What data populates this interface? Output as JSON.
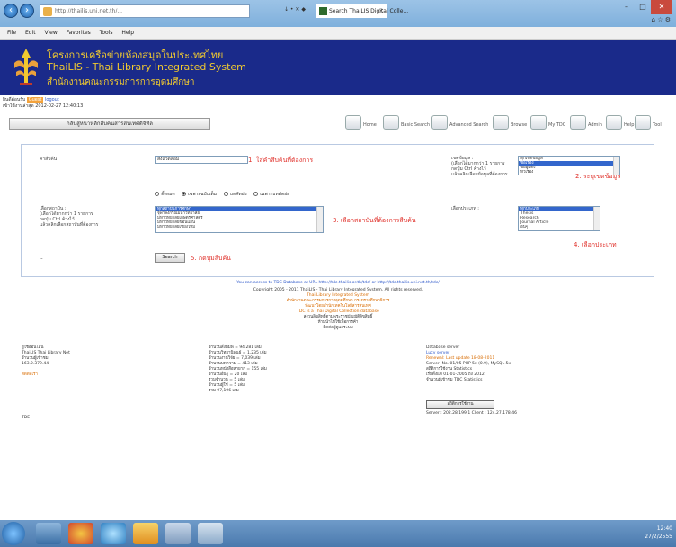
{
  "browser": {
    "address_url": "http://thailis.uni.net.th/...",
    "address_controls": "↓ • ✕ ◆",
    "tab_title": "Search ThaiLIS Digital Colle...",
    "window_controls": [
      "–",
      "□",
      "✕"
    ],
    "menu": [
      "File",
      "Edit",
      "View",
      "Favorites",
      "Tools",
      "Help"
    ]
  },
  "banner": {
    "line1": "โครงการเครือข่ายห้องสมุดในประเทศไทย",
    "line2": "ThaiLIS - Thai Library Integrated System",
    "line3": "สำนักงานคณะกรรมการการอุดมศึกษา"
  },
  "user": {
    "welcome": "ยินดีต้อนรับ",
    "username": "Guest",
    "logout": "logout",
    "last_login": "เข้าใช้งานล่าสุด 2012-02-27 12:40:13"
  },
  "back_button": "กลับสู่หน้าหลักสืบค้นสารสนเทศดิจิทัล",
  "toolbar": [
    {
      "label": "Home",
      "icon": "home-icon"
    },
    {
      "label": "Basic Search",
      "icon": "search-icon"
    },
    {
      "label": "Advanced Search",
      "icon": "advanced-search-icon"
    },
    {
      "label": "Browse",
      "icon": "browse-icon"
    },
    {
      "label": "My TDC",
      "icon": "user-icon"
    },
    {
      "label": "Admin",
      "icon": "admin-icon"
    },
    {
      "label": "Help",
      "icon": "help-icon"
    },
    {
      "label": "Tool",
      "icon": "tool-icon"
    }
  ],
  "search": {
    "keyword_label": "คำสืบค้น",
    "keyword_value": "สิ่งแวดล้อม",
    "step1": "1. ใส่คำสืบค้นที่ต้องการ",
    "field_label_lines": [
      "เขตข้อมูล :",
      "(เลือกได้มากกว่า 1 รายการ",
      "กดปุ่ม Ctrl ค้างไว้",
      "แล้วคลิกเลือกข้อมูลที่ต้องการ"
    ],
    "field_options": [
      "ทุกเขตข้อมูล",
      "ชื่อเรื่อง",
      "ชื่อผู้แต่ง",
      "หัวเรื่อง"
    ],
    "field_selected": 1,
    "step2": "2. ระบุเขตข้อมูล",
    "radio_options": [
      "ทั้งหมด",
      "เฉพาะฉบับเต็ม",
      "บทคัดย่อ",
      "เฉพาะบทคัดย่อ"
    ],
    "radio_selected": 1,
    "inst_label_lines": [
      "เลือกสถาบัน :",
      "(เลือกได้มากกว่า 1 รายการ",
      "กดปุ่ม Ctrl ค้างไว้",
      "แล้วคลิกเลือกสถาบันที่ต้องการ"
    ],
    "inst_options": [
      "ทุกสถาบันการศึกษา",
      "จุฬาลงกรณ์มหาวิทยาลัย",
      "มหาวิทยาลัยเกษตรศาสตร์",
      "มหาวิทยาลัยขอนแก่น",
      "มหาวิทยาลัยเชียงใหม่"
    ],
    "inst_selected": 0,
    "step3": "3. เลือกสถาบันที่ต้องการสืบค้น",
    "type_label": "เลือกประเภท :",
    "type_options": [
      "ทุกประเภท",
      "Thesis",
      "Research",
      "Journal Article",
      "อื่นๆ"
    ],
    "type_selected": 0,
    "step4": "4. เลือกประเภท",
    "search_button": "Search",
    "step5": "5. กดปุ่มสืบค้น"
  },
  "footer": {
    "lines": [
      "You can access to TDC Database at URL http://tdc.thailis.or.th/tdc/ or http://tdc.thailis.uni.net.th/tdc/",
      "Copyright 2005 - 2011 ThaiLIS - Thai Library Integrated System. All rights reserved.",
      "Thai Library Integrated System",
      "สำนักงานคณะกรรมการการอุดมศึกษา กระทรวงศึกษาธิการ",
      "พัฒนาโดยสำนักเทคโนโลยีสารสนเทศ",
      "TDC is a Thai Digital Collection database",
      "สงวนลิขสิทธิ์ตามพระราชบัญญัติลิขสิทธิ์",
      "ห้ามนำไปใช้เพื่อการค้า",
      "ติดต่อผู้ดูแลระบบ"
    ],
    "left_col": [
      "ผู้ใช้ออนไลน์",
      "ThaiLIS Thai Library Net",
      "จำนวนผู้เข้าชม",
      "163.2.379.44"
    ],
    "left_link": "ติดต่อเรา",
    "mid_col": [
      "จำนวนสิ่งพิมพ์ = 94,281 เล่ม",
      "จำนวนวิทยานิพนธ์ = 1,235 เล่ม",
      "จำนวนงานวิจัย = 7,039 เล่ม",
      "จำนวนบทความ = 413 เล่ม",
      "จำนวนหนังสือหายาก = 155 เล่ม",
      "จำนวนอื่นๆ = 20 เล่ม",
      "รวมจำนวน = 5 เล่ม",
      "จำนวนผู้ใช้ = 5 เล่ม",
      "รวม 97,196 เล่ม"
    ],
    "right_col": [
      "Database server",
      "Lucy server",
      "Renewal: Last update 18-08-2011",
      "Server: No. 01/05 PHP 5x (0.9), MySQL 5x",
      "สถิติการใช้งาน Statistics",
      "เริ่มตั้งแต่ 01-01-2005 ถึง 2012",
      "จำนวนผู้เข้าชม TDC Statistics"
    ],
    "stats_button": "สถิติการใช้งาน",
    "right_tail": "Server : 202.28.199.1  Client : 124.27.178.46",
    "edge_text": "TDE"
  },
  "taskbar": {
    "tray_time": "12:40",
    "tray_date": "27/2/2555"
  }
}
